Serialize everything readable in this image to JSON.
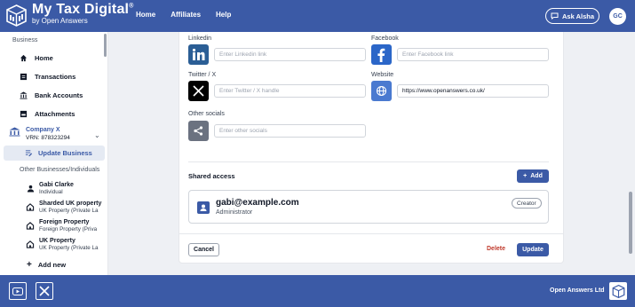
{
  "header": {
    "brand_title": "My Tax Digital",
    "brand_mark": "®",
    "brand_sub": "by Open Answers",
    "nav": [
      "Home",
      "Affiliates",
      "Help"
    ],
    "ask_label": "Ask Alsha",
    "avatar_initials": "GC",
    "color": "#3b5aa6"
  },
  "sidebar": {
    "section_business": "Business",
    "items": [
      {
        "label": "Home",
        "icon": "home-icon"
      },
      {
        "label": "Transactions",
        "icon": "transactions-icon"
      },
      {
        "label": "Bank Accounts",
        "icon": "bank-icon"
      },
      {
        "label": "Attachments",
        "icon": "attachments-icon"
      }
    ],
    "company": {
      "name": "Company X",
      "vrn": "VRN: 878323294"
    },
    "update_business": "Update Business",
    "section_other": "Other Businesses/Individuals",
    "others": [
      {
        "title": "Gabi Clarke",
        "sub": "Individual",
        "icon": "person-icon"
      },
      {
        "title": "Sharded UK property",
        "sub": "UK Property (Private La",
        "icon": "property-icon"
      },
      {
        "title": "Foreign Property",
        "sub": "Foreign Property (Priva",
        "icon": "property-icon"
      },
      {
        "title": "UK Property",
        "sub": "UK Property (Private La",
        "icon": "property-icon"
      }
    ],
    "add_new": "Add new"
  },
  "form": {
    "linkedin": {
      "label": "Linkedin",
      "placeholder": "Enter Linkedin link",
      "value": ""
    },
    "facebook": {
      "label": "Facebook",
      "placeholder": "Enter Facebook link",
      "value": ""
    },
    "twitter": {
      "label": "Twitter / X",
      "placeholder": "Enter Twitter / X handle",
      "value": ""
    },
    "website": {
      "label": "Website",
      "placeholder": "",
      "value": "https://www.openanswers.co.uk/"
    },
    "other": {
      "label": "Other socials",
      "placeholder": "Enter other socials",
      "value": ""
    }
  },
  "shared_access": {
    "title": "Shared access",
    "add_label": "Add",
    "users": [
      {
        "email": "gabi@example.com",
        "role": "Administrator",
        "badge": "Creator"
      }
    ]
  },
  "actions": {
    "cancel": "Cancel",
    "delete": "Delete",
    "update": "Update"
  },
  "footer": {
    "company": "Open Answers Ltd"
  }
}
